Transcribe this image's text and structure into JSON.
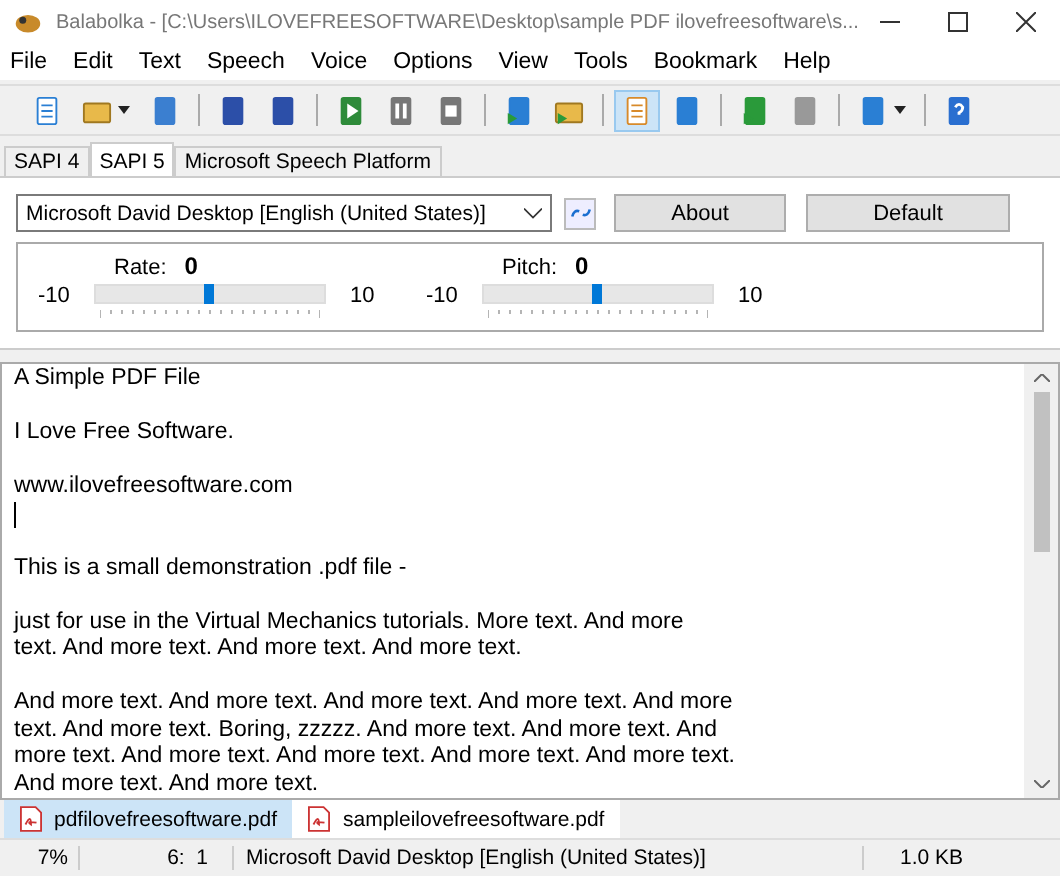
{
  "window": {
    "title": "Balabolka - [C:\\Users\\ILOVEFREESOFTWARE\\Desktop\\sample PDF ilovefreesoftware\\s..."
  },
  "menu": [
    "File",
    "Edit",
    "Text",
    "Speech",
    "Voice",
    "Options",
    "View",
    "Tools",
    "Bookmark",
    "Help"
  ],
  "toolbar": [
    {
      "kind": "new",
      "pressed": false
    },
    {
      "kind": "open",
      "pressed": false,
      "dropdown": true
    },
    {
      "kind": "save",
      "pressed": false
    },
    {
      "kind": "sep"
    },
    {
      "kind": "export",
      "pressed": false
    },
    {
      "kind": "export",
      "pressed": false
    },
    {
      "kind": "sep"
    },
    {
      "kind": "play",
      "pressed": false
    },
    {
      "kind": "pause",
      "pressed": false
    },
    {
      "kind": "stop",
      "pressed": false
    },
    {
      "kind": "sep"
    },
    {
      "kind": "clip",
      "pressed": false
    },
    {
      "kind": "folderplay",
      "pressed": false
    },
    {
      "kind": "sep"
    },
    {
      "kind": "notes",
      "pressed": true
    },
    {
      "kind": "book",
      "pressed": false
    },
    {
      "kind": "sep"
    },
    {
      "kind": "add",
      "pressed": false
    },
    {
      "kind": "remove",
      "pressed": false
    },
    {
      "kind": "sep"
    },
    {
      "kind": "convert",
      "pressed": false,
      "dropdown": true
    },
    {
      "kind": "sep"
    },
    {
      "kind": "help",
      "pressed": false
    }
  ],
  "engine_tabs": [
    {
      "label": "SAPI 4",
      "selected": false
    },
    {
      "label": "SAPI 5",
      "selected": true
    },
    {
      "label": "Microsoft Speech Platform",
      "selected": false
    }
  ],
  "voice": {
    "value": "Microsoft David Desktop [English (United States)]",
    "about": "About",
    "default": "Default"
  },
  "sliders": [
    {
      "label": "Rate:",
      "value": "0",
      "min": "-10",
      "max": "10",
      "level": 0.5
    },
    {
      "label": "Pitch:",
      "value": "0",
      "min": "-10",
      "max": "10",
      "level": 0.5
    }
  ],
  "paragraphs": [
    {
      "lines": [
        "A Simple PDF File"
      ],
      "caret_after": false
    },
    {
      "lines": [
        "I Love Free Software."
      ],
      "caret_after": false
    },
    {
      "lines": [
        "www.ilovefreesoftware.com"
      ],
      "caret_after": true
    },
    {
      "lines": [
        "This is a small demonstration .pdf file -"
      ],
      "caret_after": false
    },
    {
      "lines": [
        "just for use in the Virtual Mechanics tutorials. More text. And more",
        "text. And more text. And more text. And more text."
      ],
      "caret_after": false
    },
    {
      "lines": [
        "And more text. And more text. And more text. And more text. And more",
        "text. And more text. Boring, zzzzz. And more text. And more text. And",
        "more text. And more text. And more text. And more text. And more text.",
        "And more text. And more text."
      ],
      "caret_after": false
    }
  ],
  "doc_tabs": [
    {
      "label": "pdfilovefreesoftware.pdf",
      "selected": false
    },
    {
      "label": "sampleilovefreesoftware.pdf",
      "selected": true
    }
  ],
  "status": {
    "zoom": "7%",
    "position": "6:  1",
    "voice": "Microsoft David Desktop [English (United States)]",
    "size": "1.0 KB"
  }
}
